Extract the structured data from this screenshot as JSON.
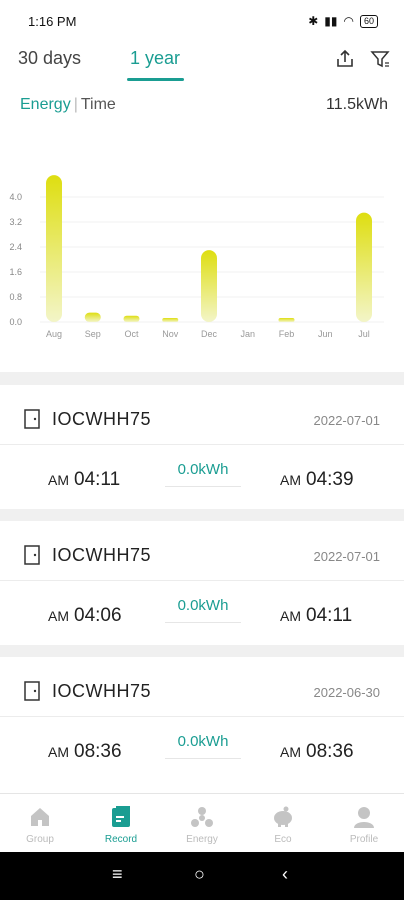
{
  "status_bar": {
    "time": "1:16 PM",
    "signal": "𝌆 ᯤ",
    "battery": "60"
  },
  "header": {
    "tabs": [
      {
        "label": "30 days"
      },
      {
        "label": "1 year"
      }
    ],
    "active_tab": 1,
    "icons": [
      "share-icon",
      "filter-icon"
    ]
  },
  "chart": {
    "mode_energy": "Energy",
    "mode_sep": "|",
    "mode_time": "Time",
    "total": "11.5kWh"
  },
  "chart_data": {
    "type": "bar",
    "categories": [
      "Aug",
      "Sep",
      "Oct",
      "Nov",
      "Dec",
      "Jan",
      "Feb",
      "Jun",
      "Jul"
    ],
    "values": [
      4.7,
      0.3,
      0.2,
      0.1,
      2.3,
      0.0,
      0.02,
      0.0,
      3.5
    ],
    "y_ticks": [
      "0.0",
      "0.8",
      "1.6",
      "2.4",
      "3.2",
      "4.0"
    ],
    "ylim": [
      0,
      4.8
    ],
    "grid": true,
    "colors": {
      "bar_top": "#dede10",
      "bar_bottom": "#f3f5c8"
    }
  },
  "records": [
    {
      "device": "IOCWHH75",
      "date": "2022-07-01",
      "start_ampm": "AM",
      "start_time": "04:11",
      "energy": "0.0kWh",
      "end_ampm": "AM",
      "end_time": "04:39"
    },
    {
      "device": "IOCWHH75",
      "date": "2022-07-01",
      "start_ampm": "AM",
      "start_time": "04:06",
      "energy": "0.0kWh",
      "end_ampm": "AM",
      "end_time": "04:11"
    },
    {
      "device": "IOCWHH75",
      "date": "2022-06-30",
      "start_ampm": "AM",
      "start_time": "08:36",
      "energy": "0.0kWh",
      "end_ampm": "AM",
      "end_time": "08:36"
    }
  ],
  "bottom_nav": {
    "items": [
      {
        "label": "Group",
        "icon": "house-icon"
      },
      {
        "label": "Record",
        "icon": "record-icon"
      },
      {
        "label": "Energy",
        "icon": "energy-icon"
      },
      {
        "label": "Eco",
        "icon": "piggy-bank-icon"
      },
      {
        "label": "Profile",
        "icon": "profile-icon"
      }
    ],
    "active": 1
  },
  "system_nav": {
    "menu": "≡",
    "home": "○",
    "back": "‹"
  },
  "colors": {
    "accent": "#1a9d92",
    "inactive": "#c4c4c4"
  }
}
